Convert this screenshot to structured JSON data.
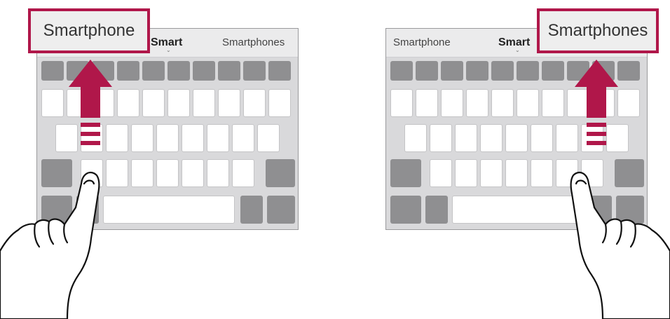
{
  "left": {
    "popup_label": "Smartphone",
    "suggestions": [
      "Smart",
      "Smartphones"
    ]
  },
  "right": {
    "popup_label": "Smartphones",
    "suggestions": [
      "Smartphone",
      "Smart"
    ]
  },
  "colors": {
    "accent": "#b0174a",
    "key_dark": "#8f8f91",
    "key_white": "#ffffff",
    "keyboard_bg": "#d9d9db"
  },
  "icons": [
    "up-arrow-icon",
    "finger-hand-icon"
  ]
}
